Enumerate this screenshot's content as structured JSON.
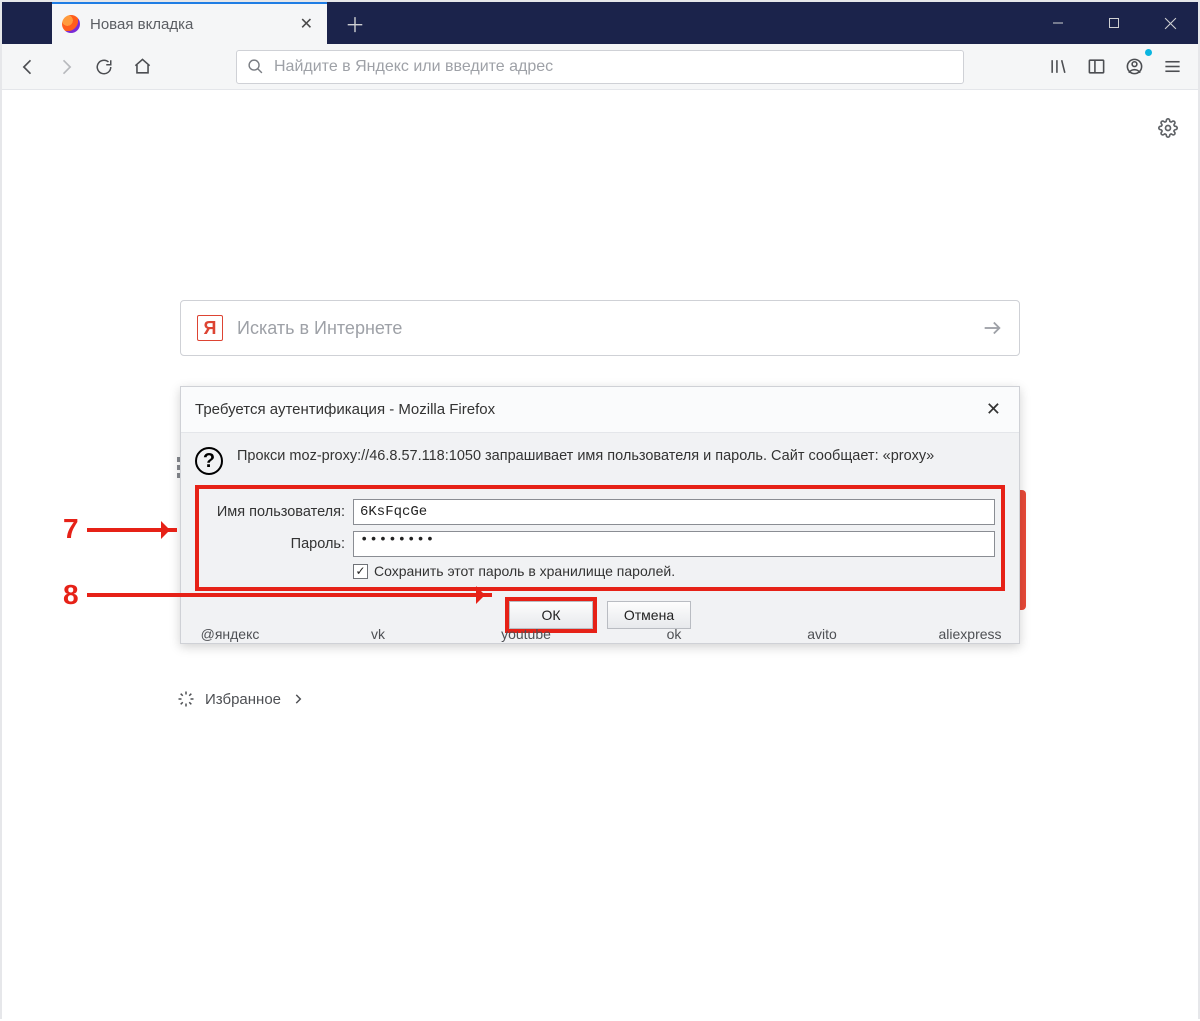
{
  "tab": {
    "title": "Новая вкладка"
  },
  "urlbar": {
    "placeholder": "Найдите в Яндекс или введите адрес"
  },
  "main_search": {
    "placeholder": "Искать в Интернете",
    "logo_letter": "Я"
  },
  "shortcuts": [
    "@яндекс",
    "vk",
    "youtube",
    "ok",
    "avito",
    "aliexpress"
  ],
  "favorites_label": "Избранное",
  "dialog": {
    "title": "Требуется аутентификация - Mozilla Firefox",
    "message": "Прокси moz-proxy://46.8.57.118:1050 запрашивает имя пользователя и пароль. Сайт сообщает: «proxy»",
    "username_label": "Имя пользователя:",
    "username_value": "6KsFqcGe",
    "password_label": "Пароль:",
    "password_value": "••••••••",
    "save_label": "Сохранить этот пароль в хранилище паролей.",
    "ok_label": "ОК",
    "cancel_label": "Отмена"
  },
  "annotations": {
    "n7": "7",
    "n8": "8"
  }
}
